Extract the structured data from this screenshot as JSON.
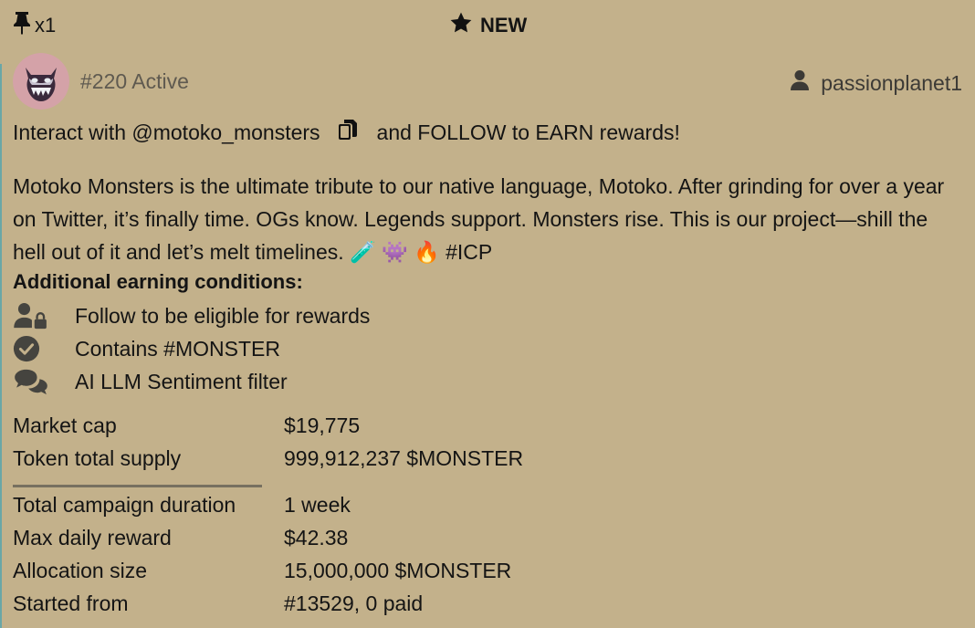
{
  "header": {
    "pin_count": "x1",
    "badge": "NEW",
    "pin_icon": "pin-icon",
    "badge_icon": "star-icon"
  },
  "campaign": {
    "status": "#220 Active",
    "owner": "passionplanet1",
    "owner_icon": "user-icon",
    "interact_prefix": "Interact with @motoko_monsters",
    "interact_suffix": "and FOLLOW to EARN rewards!",
    "copy_icon": "copy-icon",
    "description": "Motoko Monsters is the ultimate tribute to our native language, Motoko. After grinding for over a year on Twitter, it’s finally time. OGs know. Legends support. Monsters rise. This is our project—shill the hell out of it and let’s melt timelines. 🧪 👾 🔥 #ICP"
  },
  "conditions": {
    "title": "Additional earning conditions:",
    "items": [
      {
        "icon": "user-lock-icon",
        "label": "Follow to be eligible for rewards"
      },
      {
        "icon": "check-circle-icon",
        "label": "Contains #MONSTER"
      },
      {
        "icon": "comments-icon",
        "label": "AI LLM Sentiment filter"
      }
    ]
  },
  "token": {
    "market_cap_label": "Market cap",
    "market_cap": "$19,775",
    "supply_label": "Token total supply",
    "supply": "999,912,237 $MONSTER"
  },
  "stats": {
    "duration_label": "Total campaign duration",
    "duration": "1 week",
    "max_reward_label": "Max daily reward",
    "max_reward": "$42.38",
    "allocation_label": "Allocation size",
    "allocation": "15,000,000 $MONSTER",
    "started_label": "Started from",
    "started": "#13529, 0 paid"
  },
  "colors": {
    "background": "#c3b18b",
    "text": "#141414",
    "muted": "#5f5a50",
    "accent": "#6aa7a7"
  }
}
